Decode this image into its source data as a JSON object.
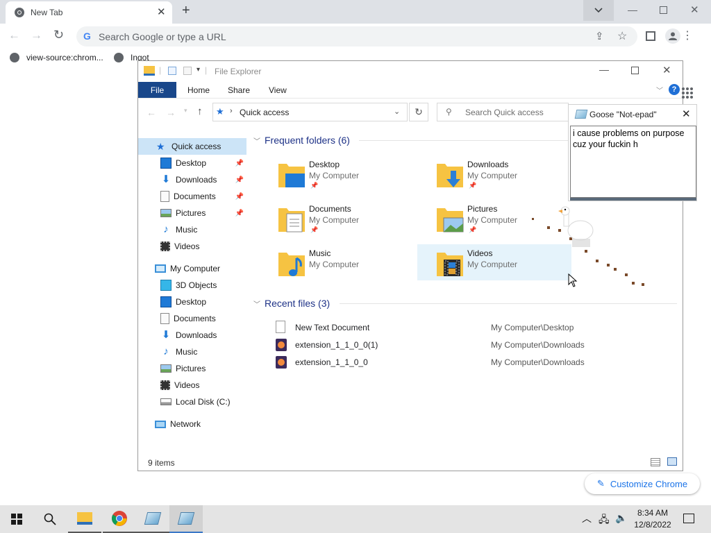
{
  "browser": {
    "tab_title": "New Tab",
    "omnibox_placeholder": "Search Google or type a URL",
    "bookmarks": [
      "view-source:chrom...",
      "Ingot"
    ],
    "customize_label": "Customize Chrome"
  },
  "explorer": {
    "title": "File Explorer",
    "ribbon_tabs": [
      "File",
      "Home",
      "Share",
      "View"
    ],
    "address": "Quick access",
    "search_placeholder": "Search Quick access",
    "nav": {
      "quick_access": "Quick access",
      "quick_items": [
        "Desktop",
        "Downloads",
        "Documents",
        "Pictures",
        "Music",
        "Videos"
      ],
      "my_computer": "My Computer",
      "computer_items": [
        "3D Objects",
        "Desktop",
        "Documents",
        "Downloads",
        "Music",
        "Pictures",
        "Videos",
        "Local Disk (C:)"
      ],
      "network": "Network"
    },
    "frequent_header": "Frequent folders (6)",
    "frequent": [
      {
        "name": "Desktop",
        "loc": "My Computer",
        "pinned": true
      },
      {
        "name": "Downloads",
        "loc": "My Computer",
        "pinned": true
      },
      {
        "name": "Documents",
        "loc": "My Computer",
        "pinned": true
      },
      {
        "name": "Pictures",
        "loc": "My Computer",
        "pinned": true
      },
      {
        "name": "Music",
        "loc": "My Computer",
        "pinned": false
      },
      {
        "name": "Videos",
        "loc": "My Computer",
        "pinned": false
      }
    ],
    "recent_header": "Recent files (3)",
    "recent": [
      {
        "name": "New Text Document",
        "path": "My Computer\\Desktop"
      },
      {
        "name": "extension_1_1_0_0(1)",
        "path": "My Computer\\Downloads"
      },
      {
        "name": "extension_1_1_0_0",
        "path": "My Computer\\Downloads"
      }
    ],
    "status": "9 items"
  },
  "notepad": {
    "title": "Goose \"Not-epad\"",
    "text_line1": "i cause problems on purpose",
    "text_line2": "cuz your fuckin h"
  },
  "taskbar": {
    "time": "8:34 AM",
    "date": "12/8/2022"
  },
  "colors": {
    "accent": "#19478a",
    "link": "#1a73e8",
    "section_header": "#1e3287",
    "folder": "#f6c342"
  }
}
